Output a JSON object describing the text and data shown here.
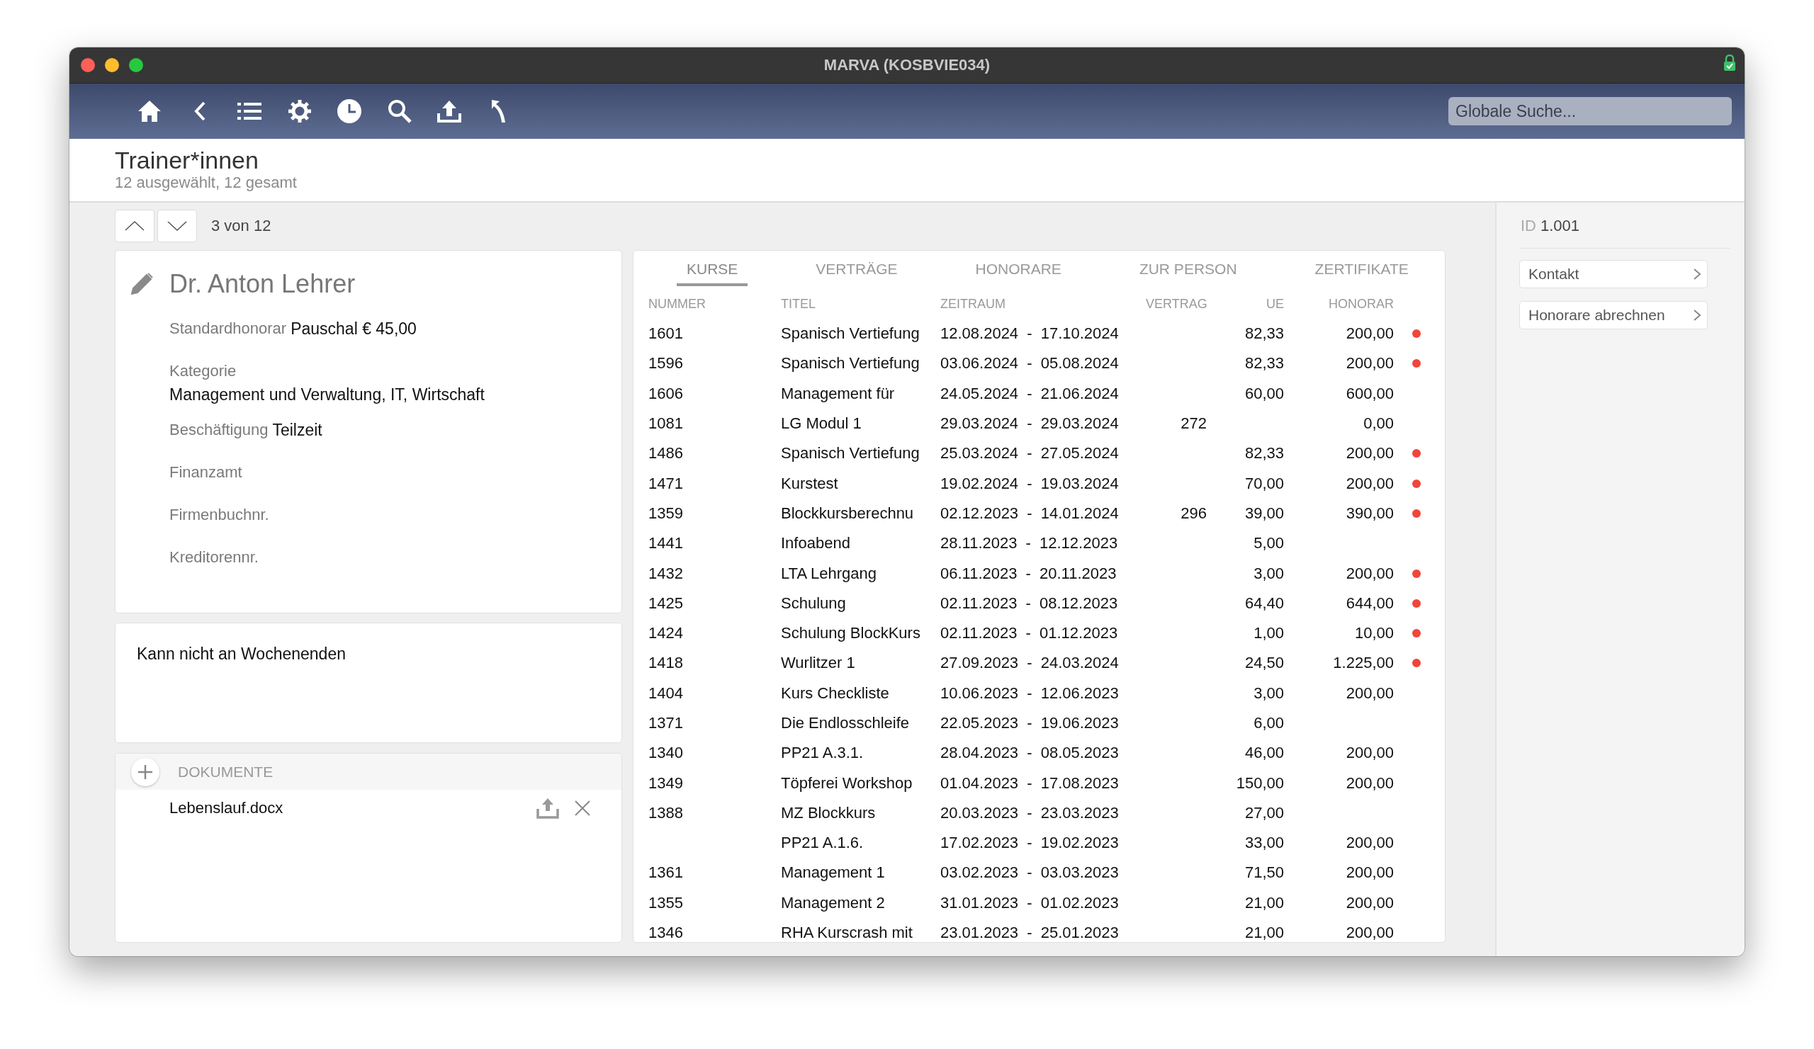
{
  "window": {
    "title": "MARVA (KOSBVIE034)"
  },
  "search": {
    "placeholder": "Globale Suche..."
  },
  "header": {
    "title": "Trainer*innen",
    "subtitle": "12 ausgewählt, 12 gesamt"
  },
  "pager": {
    "position": "3 von 12"
  },
  "person": {
    "name": "Dr. Anton Lehrer",
    "fields": [
      {
        "kind": "inline",
        "label": "Standardhonorar",
        "value": "Pauschal € 45,00"
      },
      {
        "kind": "stacked",
        "label": "Kategorie",
        "value": "Management und Verwaltung, IT, Wirtschaft"
      },
      {
        "kind": "inline",
        "label": "Beschäftigung",
        "value": "Teilzeit"
      },
      {
        "kind": "inline",
        "label": "Finanzamt"
      },
      {
        "kind": "inline",
        "label": "Firmenbuchnr."
      },
      {
        "kind": "inline",
        "label": "Kreditorennr."
      }
    ]
  },
  "note": {
    "text": "Kann nicht an Wochenenden"
  },
  "documents": {
    "title": "DOKUMENTE",
    "files": [
      {
        "name": "Lebenslauf.docx"
      }
    ]
  },
  "tabs": [
    {
      "label": "KURSE",
      "selected": true
    },
    {
      "label": "VERTRÄGE",
      "selected": false
    },
    {
      "label": "HONORARE",
      "selected": false
    },
    {
      "label": "ZUR PERSON",
      "selected": false
    },
    {
      "label": "ZERTIFIKATE",
      "selected": false
    }
  ],
  "table": {
    "columns": [
      "NUMMER",
      "TITEL",
      "ZEITRAUM",
      "VERTRAG",
      "UE",
      "HONORAR"
    ],
    "rows": [
      {
        "nummer": "1601",
        "titel": "Spanisch Vertiefung",
        "zeitraum": "12.08.2024 - 17.10.2024",
        "ue": "82,33",
        "honorar": "200,00",
        "flagged": true
      },
      {
        "nummer": "1596",
        "titel": "Spanisch Vertiefung",
        "zeitraum": "03.06.2024 - 05.08.2024",
        "ue": "82,33",
        "honorar": "200,00",
        "flagged": true
      },
      {
        "nummer": "1606",
        "titel": "Management für",
        "zeitraum": "24.05.2024 - 21.06.2024",
        "ue": "60,00",
        "honorar": "600,00",
        "flagged": false
      },
      {
        "nummer": "1081",
        "titel": "LG Modul 1",
        "zeitraum": "29.03.2024 - 29.03.2024",
        "vertrag": "272",
        "honorar": "0,00",
        "flagged": false
      },
      {
        "nummer": "1486",
        "titel": "Spanisch Vertiefung",
        "zeitraum": "25.03.2024 - 27.05.2024",
        "ue": "82,33",
        "honorar": "200,00",
        "flagged": true
      },
      {
        "nummer": "1471",
        "titel": "Kurstest",
        "zeitraum": "19.02.2024 - 19.03.2024",
        "ue": "70,00",
        "honorar": "200,00",
        "flagged": true
      },
      {
        "nummer": "1359",
        "titel": "Blockkursberechnu",
        "zeitraum": "02.12.2023 - 14.01.2024",
        "vertrag": "296",
        "ue": "39,00",
        "honorar": "390,00",
        "flagged": true
      },
      {
        "nummer": "1441",
        "titel": "Infoabend",
        "zeitraum": "28.11.2023 - 12.12.2023",
        "ue": "5,00",
        "flagged": false
      },
      {
        "nummer": "1432",
        "titel": "LTA Lehrgang",
        "zeitraum": "06.11.2023 - 20.11.2023",
        "ue": "3,00",
        "honorar": "200,00",
        "flagged": true
      },
      {
        "nummer": "1425",
        "titel": "Schulung",
        "zeitraum": "02.11.2023 - 08.12.2023",
        "ue": "64,40",
        "honorar": "644,00",
        "flagged": true
      },
      {
        "nummer": "1424",
        "titel": "Schulung BlockKurs",
        "zeitraum": "02.11.2023 - 01.12.2023",
        "ue": "1,00",
        "honorar": "10,00",
        "flagged": true
      },
      {
        "nummer": "1418",
        "titel": "Wurlitzer 1",
        "zeitraum": "27.09.2023 - 24.03.2024",
        "ue": "24,50",
        "honorar": "1.225,00",
        "flagged": true
      },
      {
        "nummer": "1404",
        "titel": "Kurs Checkliste",
        "zeitraum": "10.06.2023 - 12.06.2023",
        "ue": "3,00",
        "honorar": "200,00",
        "flagged": false
      },
      {
        "nummer": "1371",
        "titel": "Die Endlosschleife",
        "zeitraum": "22.05.2023 - 19.06.2023",
        "ue": "6,00",
        "flagged": false
      },
      {
        "nummer": "1340",
        "titel": "PP21 A.3.1.",
        "zeitraum": "28.04.2023 - 08.05.2023",
        "ue": "46,00",
        "honorar": "200,00",
        "flagged": false
      },
      {
        "nummer": "1349",
        "titel": "Töpferei Workshop",
        "zeitraum": "01.04.2023 - 17.08.2023",
        "ue": "150,00",
        "honorar": "200,00",
        "flagged": false
      },
      {
        "nummer": "1388",
        "titel": "MZ Blockkurs",
        "zeitraum": "20.03.2023 - 23.03.2023",
        "ue": "27,00",
        "flagged": false
      },
      {
        "titel": "PP21 A.1.6.",
        "zeitraum": "17.02.2023 - 19.02.2023",
        "ue": "33,00",
        "honorar": "200,00",
        "flagged": false
      },
      {
        "nummer": "1361",
        "titel": "Management 1",
        "zeitraum": "03.02.2023 - 03.03.2023",
        "ue": "71,50",
        "honorar": "200,00",
        "flagged": false
      },
      {
        "nummer": "1355",
        "titel": "Management 2",
        "zeitraum": "31.01.2023 - 01.02.2023",
        "ue": "21,00",
        "honorar": "200,00",
        "flagged": false
      },
      {
        "nummer": "1346",
        "titel": "RHA Kurscrash mit",
        "zeitraum": "23.01.2023 - 25.01.2023",
        "ue": "21,00",
        "honorar": "200,00",
        "flagged": false
      }
    ]
  },
  "sidebar": {
    "id_label": "ID",
    "id_value": "1.001",
    "links": [
      "Kontakt",
      "Honorare abrechnen"
    ]
  }
}
